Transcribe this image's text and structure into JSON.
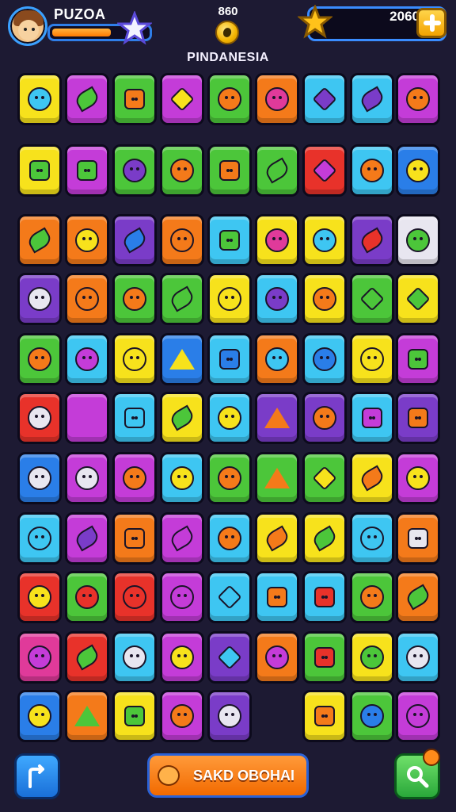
{
  "header": {
    "player_name": "PUZOA",
    "xp_progress": 0.62,
    "coin_count": "860",
    "level_title": "PINDANESIA",
    "score": "2060"
  },
  "footer": {
    "action_label": "SAKD OBOHAI"
  },
  "palette": {
    "yellow": "#f7e21c",
    "magenta": "#c43cd8",
    "green": "#4cc63a",
    "orange": "#f47a1a",
    "cyan": "#3ec6f2",
    "purple": "#7a3cc8",
    "red": "#e8322a",
    "pink": "#e03a9a",
    "blue": "#2a7ee8",
    "white": "#e8e6f0"
  },
  "board": {
    "rows": [
      [
        "yellow:blob:cyan",
        "magenta:leaf:green",
        "green:square:orange",
        "magenta:diamond:yellow",
        "green:blob:orange",
        "orange:blob:pink",
        "cyan:diamond:purple",
        "cyan:leaf:purple",
        "magenta:blob:orange"
      ],
      [
        "yellow:square:green",
        "magenta:square:green",
        "green:blob:purple",
        "green:blob:orange",
        "green:square:orange",
        "green:leaf:green",
        "red:diamond:magenta",
        "cyan:blob:orange",
        "blue:blob:yellow"
      ],
      [
        "orange:leaf:green",
        "orange:blob:yellow",
        "purple:leaf:blue",
        "orange:blob:orange",
        "cyan:square:green",
        "yellow:blob:pink",
        "yellow:blob:cyan",
        "purple:leaf:red",
        "white:blob:green"
      ],
      [
        "purple:blob:white",
        "orange:blob:orange",
        "green:blob:orange",
        "green:leaf:green",
        "yellow:blob:yellow",
        "cyan:blob:purple",
        "yellow:blob:orange",
        "green:diamond:green",
        "yellow:diamond:green"
      ],
      [
        "green:blob:orange",
        "cyan:blob:magenta",
        "yellow:blob:yellow",
        "blue:tri:yellow",
        "cyan:square:blue",
        "orange:blob:cyan",
        "cyan:blob:blue",
        "yellow:blob:yellow",
        "magenta:square:green"
      ],
      [
        "red:blob:white",
        "magenta:tri:magenta",
        "cyan:square:cyan",
        "yellow:leaf:green",
        "cyan:blob:yellow",
        "purple:tri:orange",
        "purple:blob:orange",
        "cyan:square:magenta",
        "purple:square:orange"
      ],
      [
        "blue:blob:white",
        "magenta:blob:white",
        "magenta:blob:orange",
        "cyan:blob:yellow",
        "green:blob:orange",
        "green:tri:orange",
        "green:diamond:yellow",
        "yellow:leaf:orange",
        "magenta:blob:yellow"
      ],
      [
        "cyan:blob:cyan",
        "magenta:leaf:purple",
        "orange:square:orange",
        "magenta:leaf:magenta",
        "cyan:blob:orange",
        "yellow:leaf:orange",
        "yellow:leaf:green",
        "cyan:blob:cyan",
        "orange:square:white"
      ],
      [
        "red:blob:yellow",
        "green:blob:red",
        "red:blob:red",
        "magenta:blob:magenta",
        "cyan:diamond:cyan",
        "cyan:square:orange",
        "cyan:square:red",
        "green:blob:orange",
        "orange:leaf:green"
      ],
      [
        "pink:blob:magenta",
        "red:leaf:green",
        "cyan:blob:white",
        "magenta:blob:yellow",
        "purple:diamond:cyan",
        "orange:blob:magenta",
        "green:square:red",
        "yellow:blob:green",
        "cyan:blob:white"
      ],
      [
        "blue:blob:yellow",
        "orange:tri:green",
        "yellow:square:green",
        "magenta:blob:orange",
        "purple:blob:white",
        "",
        "yellow:square:orange",
        "green:blob:blue",
        "magenta:blob:magenta"
      ]
    ]
  }
}
